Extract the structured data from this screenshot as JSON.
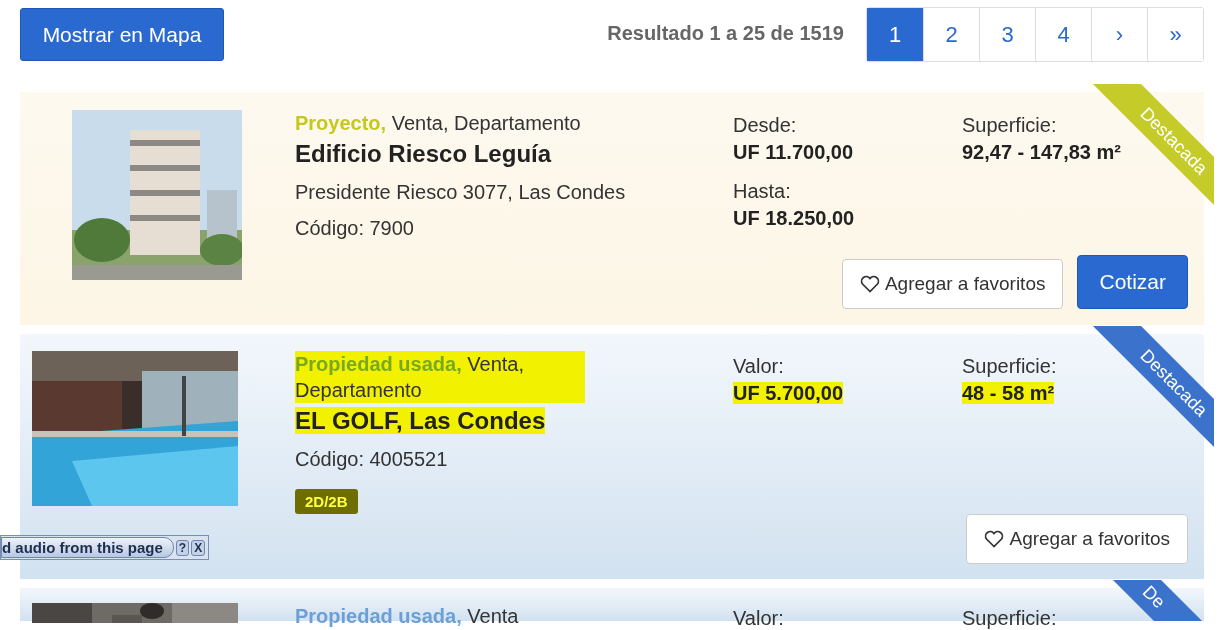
{
  "map_button": "Mostrar en Mapa",
  "results": "Resultado 1 a 25 de 1519",
  "pagination": [
    {
      "label": "1",
      "selected": true
    },
    {
      "label": "2",
      "selected": false
    },
    {
      "label": "3",
      "selected": false
    },
    {
      "label": "4",
      "selected": false
    },
    {
      "label": "›",
      "selected": false
    },
    {
      "label": "»",
      "selected": false
    }
  ],
  "listings": [
    {
      "kind": "project",
      "highlighted": false,
      "category": {
        "text": "Proyecto,",
        "color": "#c6c91c"
      },
      "type": "Venta, Departamento",
      "title": "Edificio Riesco Leguía",
      "address": "Presidente Riesco 3077, Las Condes",
      "code": "Código: 7900",
      "prices": [
        {
          "label": "Desde:",
          "value": "UF 11.700,00"
        },
        {
          "label": "Hasta:",
          "value": "UF 18.250,00"
        }
      ],
      "area": {
        "label": "Superficie:",
        "value": "92,47 - 147,83 m²"
      },
      "ribbon": {
        "label": "Destacada",
        "color": "#c5cc2a"
      },
      "buttons": [
        {
          "label": "Agregar a favoritos",
          "kind": "favorite"
        },
        {
          "label": "Cotizar",
          "kind": "primary"
        }
      ]
    },
    {
      "kind": "used",
      "highlighted": true,
      "category": {
        "text": "Propiedad usada,",
        "color": "#7aa81e"
      },
      "type": "Venta, Departamento",
      "title": "EL GOLF, Las Condes",
      "code": "Código: 4005521",
      "tag": "2D/2B",
      "prices": [
        {
          "label": "Valor:",
          "value": "UF 5.700,00"
        }
      ],
      "area": {
        "label": "Superficie:",
        "value": "48 - 58 m²"
      },
      "ribbon": {
        "label": "Destacada",
        "color": "#3a72cc"
      },
      "buttons": [
        {
          "label": "Agregar a favoritos",
          "kind": "favorite"
        }
      ]
    },
    {
      "kind": "used",
      "highlighted": false,
      "category": {
        "text": "Propiedad usada,",
        "color": "#6b9fd6"
      },
      "type": "Venta",
      "prices": [
        {
          "label": "Valor:"
        }
      ],
      "area": {
        "label": "Superficie:"
      },
      "ribbon": {
        "label": "De",
        "color": "#3a72cc"
      }
    }
  ],
  "audio_bar": {
    "text": "d audio from this page",
    "help": "?",
    "close": "X"
  }
}
